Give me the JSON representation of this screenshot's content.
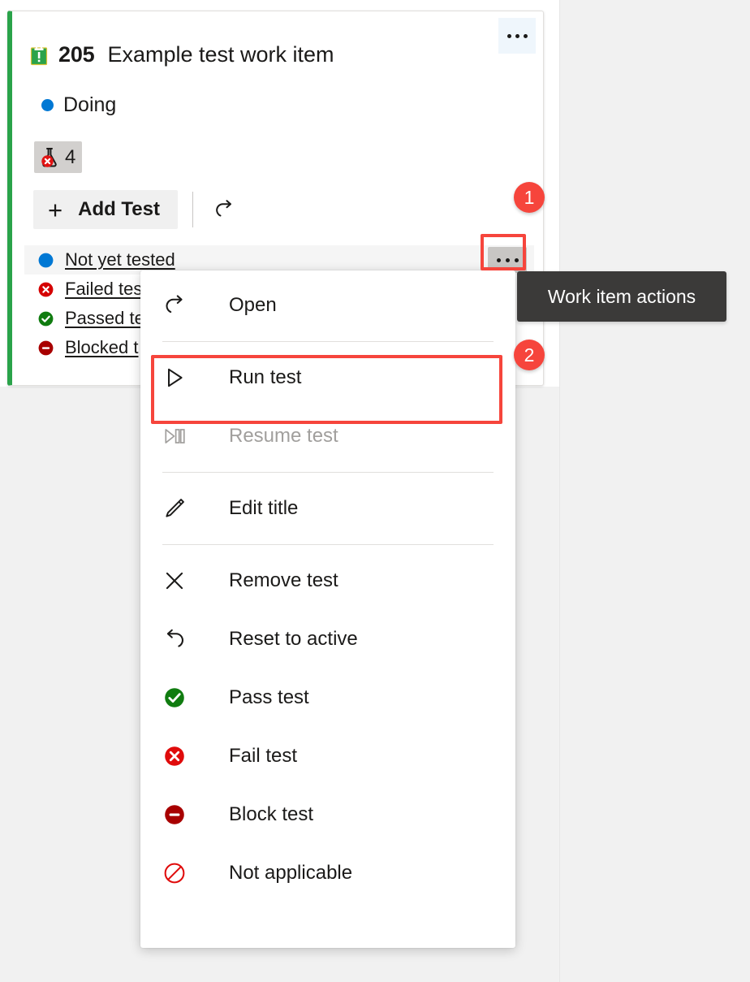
{
  "card": {
    "work_item_icon": "task-clipboard-icon",
    "id": "205",
    "title": "Example test work item",
    "state": "Doing",
    "state_color": "#0078d4",
    "accent_color": "#2aa34a",
    "test_count_chip": {
      "icon": "failed-flask-icon",
      "count": "4"
    },
    "actions_button": "work-item-actions-ellipsis"
  },
  "toolbar": {
    "add_test_label": "Add Test",
    "add_test_plus": "+",
    "refresh_icon": "open-arrow-icon"
  },
  "test_list": [
    {
      "label": "Not yet tested",
      "status": "not-run",
      "color": "#0078d4",
      "selected": true
    },
    {
      "label": "Failed tes",
      "status": "failed",
      "color": "#d50000",
      "selected": false
    },
    {
      "label": "Passed te",
      "status": "passed",
      "color": "#107c10",
      "selected": false
    },
    {
      "label": "Blocked t",
      "status": "blocked",
      "color": "#a80000",
      "selected": false
    }
  ],
  "row_actions_button": "test-row-actions-ellipsis",
  "context_menu": {
    "items": [
      {
        "label": "Open",
        "icon": "open-arrow-icon",
        "disabled": false,
        "separator_after": true
      },
      {
        "label": "Run test",
        "icon": "play-icon",
        "disabled": false,
        "separator_after": false
      },
      {
        "label": "Resume test",
        "icon": "play-pause-icon",
        "disabled": true,
        "separator_after": true
      },
      {
        "label": "Edit title",
        "icon": "pencil-icon",
        "disabled": false,
        "separator_after": true
      },
      {
        "label": "Remove test",
        "icon": "close-x-icon",
        "disabled": false,
        "separator_after": false
      },
      {
        "label": "Reset to active",
        "icon": "undo-arrow-icon",
        "disabled": false,
        "separator_after": false
      },
      {
        "label": "Pass test",
        "icon": "pass-check-icon",
        "disabled": false,
        "separator_after": false
      },
      {
        "label": "Fail test",
        "icon": "fail-x-icon",
        "disabled": false,
        "separator_after": false
      },
      {
        "label": "Block test",
        "icon": "block-minus-icon",
        "disabled": false,
        "separator_after": false
      },
      {
        "label": "Not applicable",
        "icon": "not-applicable-icon",
        "disabled": false,
        "separator_after": false
      }
    ]
  },
  "tooltip": {
    "text": "Work item actions"
  },
  "annotations": {
    "highlight_color": "#f6453c",
    "steps": [
      {
        "number": "1"
      },
      {
        "number": "2"
      }
    ]
  }
}
